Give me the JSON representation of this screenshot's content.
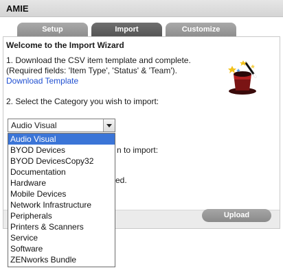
{
  "app": {
    "title": "AMIE"
  },
  "tabs": [
    {
      "label": "Setup",
      "active": false
    },
    {
      "label": "Import",
      "active": true
    },
    {
      "label": "Customize",
      "active": false
    }
  ],
  "wizard": {
    "heading": "Welcome to the Import Wizard",
    "step1_line1": "1. Download the CSV item template and complete.",
    "step1_line2": "(Required fields: 'Item Type', 'Status' & 'Team').",
    "download_link": "Download Template",
    "step2": "2. Select the Category you wish to import:",
    "obscured_step_fragment": "n to import:",
    "obscured_line_fragment": "ed."
  },
  "category_select": {
    "value": "Audio Visual",
    "options": [
      "Audio Visual",
      "BYOD Devices",
      "BYOD DevicesCopy32",
      "Documentation",
      "Hardware",
      "Mobile Devices",
      "Network Infrastructure",
      "Peripherals",
      "Printers & Scanners",
      "Service",
      "Software",
      "ZENworks Bundle"
    ],
    "selected_index": 0
  },
  "buttons": {
    "upload": "Upload"
  },
  "icons": {
    "wizard": "magic-hat-icon",
    "dropdown": "chevron-down-icon"
  },
  "colors": {
    "selection": "#3b75d7",
    "link": "#1f4fd1",
    "active_tab": "#5f5f5f",
    "inactive_tab": "#9c9c9c"
  }
}
